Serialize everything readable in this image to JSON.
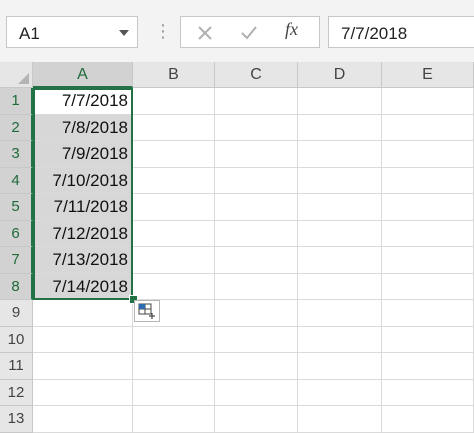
{
  "formula_bar": {
    "name_box": "A1",
    "formula": "7/7/2018",
    "function_label": "fx"
  },
  "columns": [
    "A",
    "B",
    "C",
    "D",
    "E"
  ],
  "rows": [
    "1",
    "2",
    "3",
    "4",
    "5",
    "6",
    "7",
    "8",
    "9",
    "10",
    "11",
    "12",
    "13"
  ],
  "column_a_values": [
    "7/7/2018",
    "7/8/2018",
    "7/9/2018",
    "7/10/2018",
    "7/11/2018",
    "7/12/2018",
    "7/13/2018",
    "7/14/2018"
  ],
  "selection": {
    "active_column": "A",
    "row_count": 8
  },
  "colors": {
    "accent": "#217346",
    "selected_fill": "#d7d7d7",
    "header_bg": "#e6e6e6"
  },
  "icons": {
    "name_box_dropdown": "chevron-down-icon",
    "cancel": "x-icon",
    "enter": "check-icon",
    "fill_options": "auto-fill-options-icon"
  }
}
